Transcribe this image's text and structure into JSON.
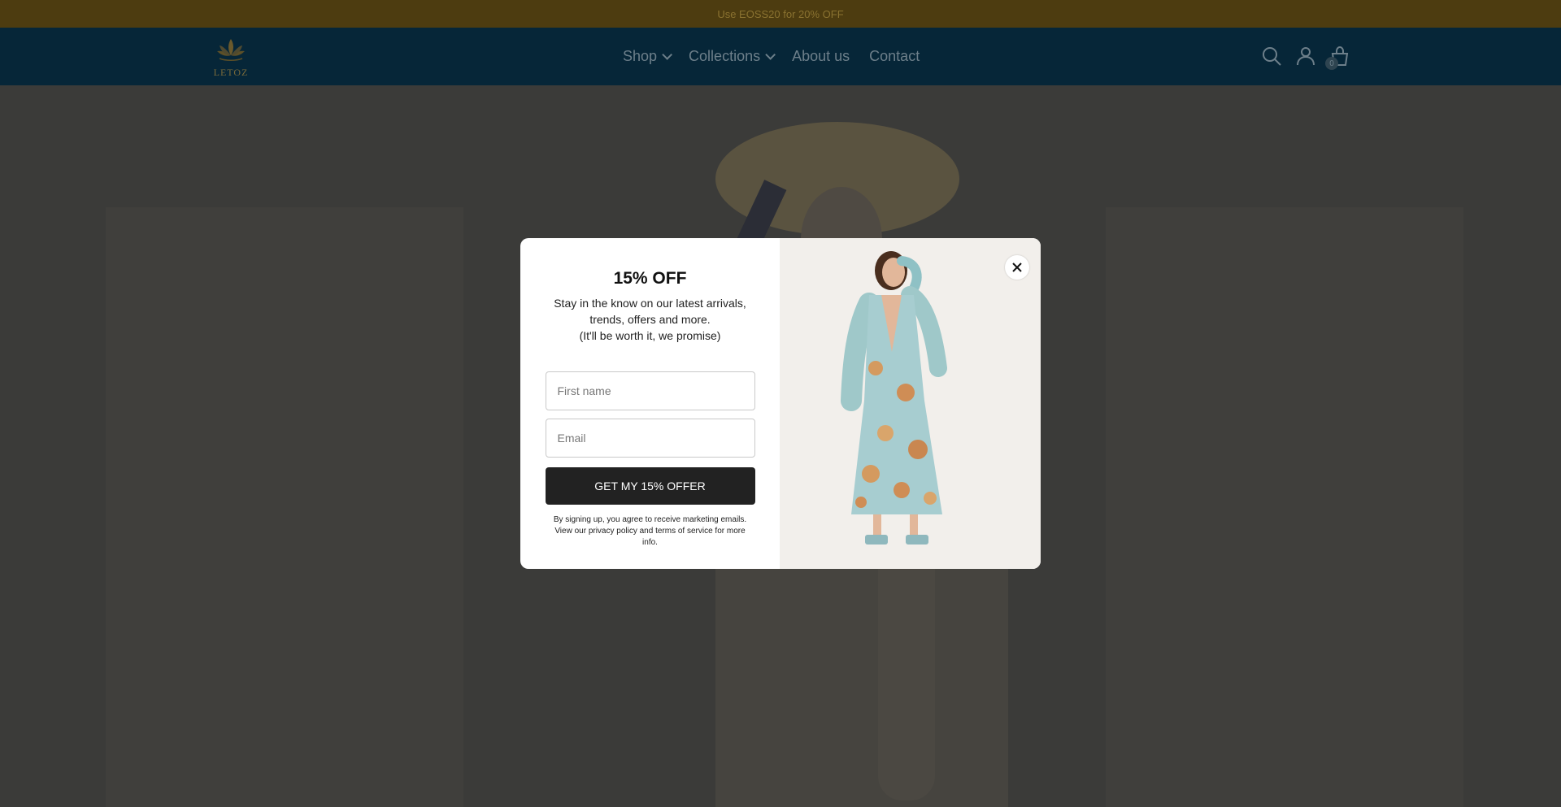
{
  "announcement": {
    "text": "Use EOSS20 for 20% OFF"
  },
  "header": {
    "logo_text": "LETOZ",
    "nav": [
      {
        "label": "Shop",
        "has_dropdown": true
      },
      {
        "label": "Collections",
        "has_dropdown": true
      },
      {
        "label": "About us",
        "has_dropdown": false
      },
      {
        "label": "Contact",
        "has_dropdown": false
      }
    ],
    "icons": [
      "search-icon",
      "account-icon",
      "cart-icon"
    ],
    "cart_count": "0"
  },
  "popup": {
    "title": "15% OFF",
    "description_line1": "Stay in the know on our latest arrivals,",
    "description_line2": "trends, offers and more.",
    "description_line3": "(It'll be worth it, we promise)",
    "first_name_placeholder": "First name",
    "email_placeholder": "Email",
    "cta_label": "GET MY 15% OFFER",
    "legal_text": "By signing up, you agree to receive marketing emails. View our privacy policy and terms of service for more info."
  },
  "colors": {
    "announcement_bg": "#4d3c10",
    "header_bg": "#062638",
    "cta_bg": "#222222"
  }
}
